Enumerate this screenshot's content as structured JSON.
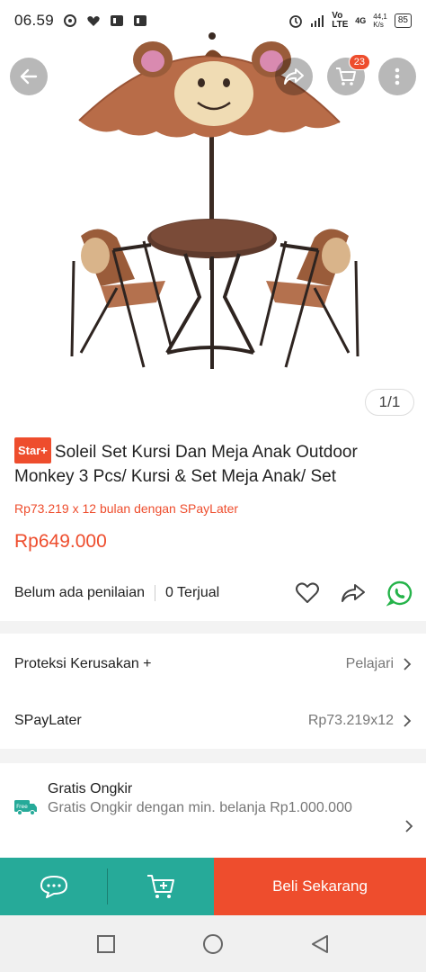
{
  "status_bar": {
    "time": "06.59",
    "network": "Vo LTE",
    "signal_type": "4G",
    "speed_value": "44,1",
    "speed_unit": "K/s",
    "battery": "85"
  },
  "top_actions": {
    "cart_count": "23"
  },
  "gallery": {
    "counter": "1/1"
  },
  "product": {
    "badge": "Star+",
    "title": "Soleil Set Kursi Dan Meja Anak Outdoor Monkey 3 Pcs/ Kursi & Set Meja Anak/ Set",
    "paylater_text": "Rp73.219 x 12 bulan dengan SPayLater",
    "price": "Rp649.000",
    "rating_text": "Belum ada penilaian",
    "sold_text": "0 Terjual"
  },
  "rows": {
    "protection_label": "Proteksi Kerusakan +",
    "protection_value": "Pelajari",
    "spaylater_label": "SPayLater",
    "spaylater_value": "Rp73.219x12"
  },
  "shipping": {
    "title": "Gratis Ongkir",
    "detail": "Gratis Ongkir dengan min. belanja Rp1.000.000",
    "icon_label": "Free"
  },
  "bottom_bar": {
    "buy_label": "Beli Sekarang"
  },
  "colors": {
    "brand": "#ee4d2d",
    "accent_teal": "#26aa99",
    "whatsapp": "#25b34a"
  },
  "icons": {
    "back": "arrow-left-icon",
    "share": "share-icon",
    "cart": "cart-icon",
    "more": "more-vertical-icon",
    "like": "heart-icon",
    "whatsapp": "whatsapp-icon",
    "chat": "chat-icon",
    "add_cart": "add-to-cart-icon"
  }
}
